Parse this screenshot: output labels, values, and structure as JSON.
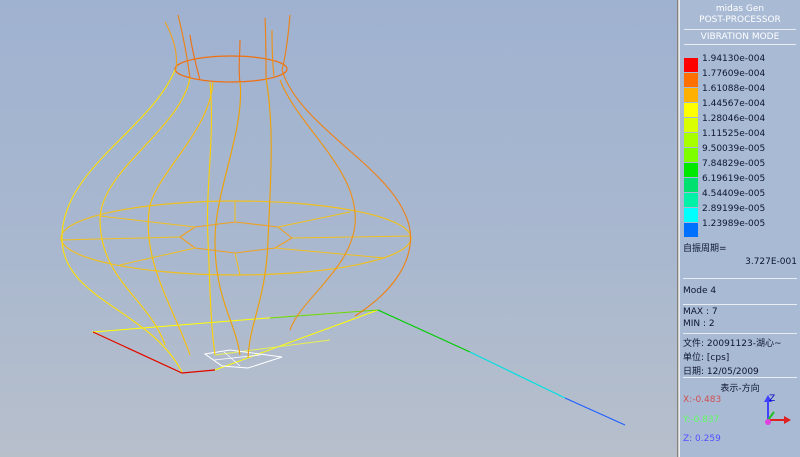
{
  "panel": {
    "app_name": "midas Gen",
    "module": "POST-PROCESSOR",
    "mode_title": "VIBRATION MODE",
    "legend": [
      {
        "value": "1.94130e-004",
        "color": "#ff0000"
      },
      {
        "value": "1.77609e-004",
        "color": "#ff7000"
      },
      {
        "value": "1.61088e-004",
        "color": "#ffb000"
      },
      {
        "value": "1.44567e-004",
        "color": "#ffff00"
      },
      {
        "value": "1.28046e-004",
        "color": "#d9ff00"
      },
      {
        "value": "1.11525e-004",
        "color": "#a8ff00"
      },
      {
        "value": "9.50039e-005",
        "color": "#7dff00"
      },
      {
        "value": "7.84829e-005",
        "color": "#00e800"
      },
      {
        "value": "6.19619e-005",
        "color": "#00e070"
      },
      {
        "value": "4.54409e-005",
        "color": "#00f0a8"
      },
      {
        "value": "2.89199e-005",
        "color": "#00ffff"
      },
      {
        "value": "1.23989e-005",
        "color": "#0070ff"
      }
    ],
    "period_label": "自振周期=",
    "period_value": "3.727E-001",
    "mode": "Mode 4",
    "max": "MAX : 7",
    "min": "MIN : 2",
    "file": "文件: 20091123-湖心~",
    "unit": "单位: [cps]",
    "date": "日期: 12/05/2009",
    "view_dir_title": "表示-方向",
    "axis_x": "X:-0.483",
    "axis_y": "Y:-0.837",
    "axis_z": "Z: 0.259",
    "axis_colors": {
      "x": "#d05050",
      "y": "#60ff60",
      "z": "#5050ff"
    }
  }
}
